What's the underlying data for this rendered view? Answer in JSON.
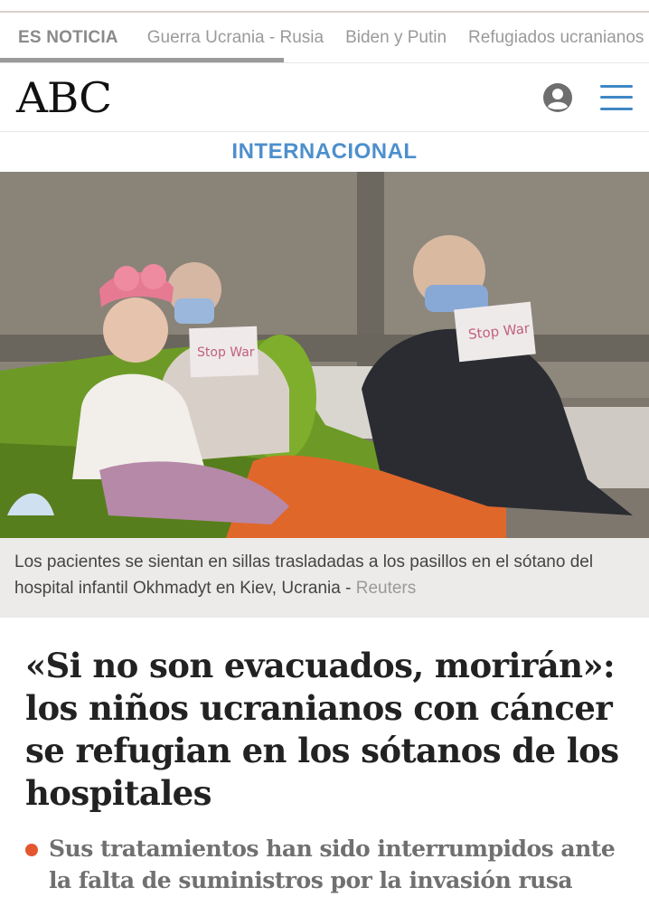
{
  "trending": {
    "label": "ES NOTICIA",
    "items": [
      "Guerra Ucrania - Rusia",
      "Biden y Putin",
      "Refugiados ucranianos"
    ]
  },
  "header": {
    "logo": "ABC",
    "user_icon": "user-icon",
    "menu_icon": "hamburger-menu-icon"
  },
  "section": {
    "title": "INTERNACIONAL"
  },
  "photo": {
    "sign_left": "Stop War",
    "sign_right": "Stop War"
  },
  "caption": {
    "text": "Los pacientes se sientan en sillas trasladadas a los pasillos en el sótano del hospital infantil Okhmadyt en Kiev, Ucrania - ",
    "credit": "Reuters"
  },
  "article": {
    "headline": "«Si no son evacuados, morirán»: los niños ucranianos con cáncer se refugian en los sótanos de los hospitales",
    "subheads": [
      "Sus tratamientos han sido interrumpidos ante la falta de suministros por la invasión rusa"
    ]
  },
  "colors": {
    "accent_blue": "#4e8fcc",
    "bullet_orange": "#e4572e"
  }
}
